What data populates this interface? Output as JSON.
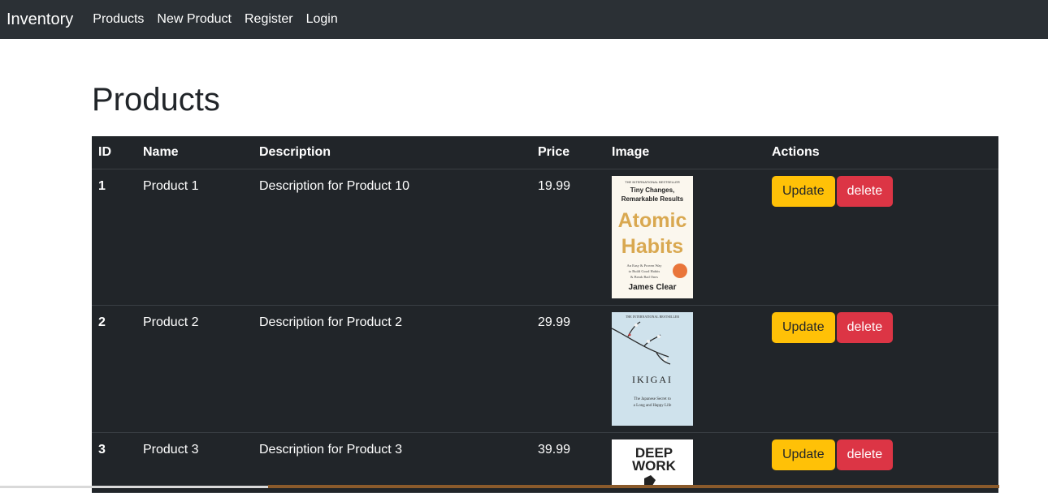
{
  "navbar": {
    "brand": "Inventory",
    "links": [
      "Products",
      "New Product",
      "Register",
      "Login"
    ]
  },
  "page": {
    "title": "Products"
  },
  "table": {
    "headers": [
      "ID",
      "Name",
      "Description",
      "Price",
      "Image",
      "Actions"
    ],
    "rows": [
      {
        "id": "1",
        "name": "Product 1",
        "description": "Description for Product 10",
        "price": "19.99",
        "update_label": "Update",
        "delete_label": "delete",
        "cover": {
          "top": "THE INTERNATIONAL BESTSELLER",
          "subtitle1": "Tiny Changes,",
          "subtitle2": "Remarkable Results",
          "title1": "Atomic",
          "title2": "Habits",
          "tagline1": "An Easy & Proven Way",
          "tagline2": "to Build Good Habits",
          "tagline3": "& Break Bad Ones",
          "author": "James Clear"
        }
      },
      {
        "id": "2",
        "name": "Product 2",
        "description": "Description for Product 2",
        "price": "29.99",
        "update_label": "Update",
        "delete_label": "delete",
        "cover": {
          "top": "THE INTERNATIONAL BESTSELLER",
          "title": "IKIGAI",
          "tagline1": "The Japanese Secret to",
          "tagline2": "a Long and Happy Life"
        }
      },
      {
        "id": "3",
        "name": "Product 3",
        "description": "Description for Product 3",
        "price": "39.99",
        "update_label": "Update",
        "delete_label": "delete",
        "cover": {
          "title1": "DEEP",
          "title2": "WORK"
        }
      }
    ]
  },
  "colors": {
    "navbar_bg": "#2b3035",
    "table_bg": "#212529",
    "update_button": "#ffc107",
    "delete_button": "#dc3545"
  }
}
